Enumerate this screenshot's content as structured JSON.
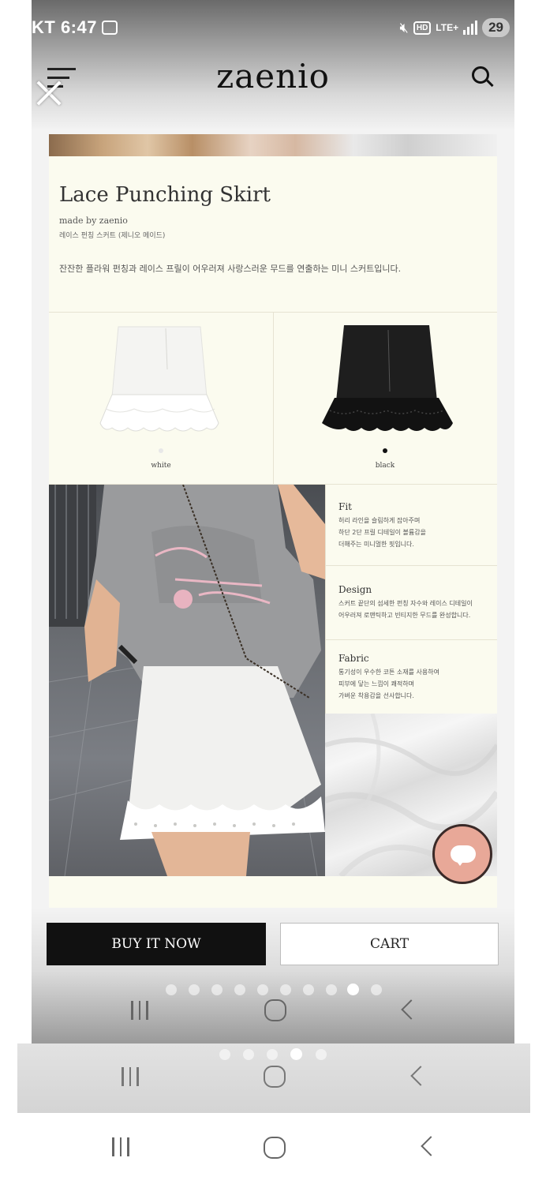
{
  "status_bar": {
    "carrier_time": "KT 6:47",
    "hd_label": "HD",
    "network": "LTE+",
    "battery": "29"
  },
  "header": {
    "brand": "zaenio"
  },
  "product": {
    "title": "Lace Punching Skirt",
    "made_by": "made by zaenio",
    "korean_name": "레이스 펀칭 스커트 (제니오 메이드)",
    "description": "잔잔한 플라워 펀칭과 레이스 프릴이 어우러져 사랑스러운 무드를 연출하는 미니 스커트입니다.",
    "colors": [
      {
        "label": "white",
        "swatch": "#e8e8e8"
      },
      {
        "label": "black",
        "swatch": "#111111"
      }
    ],
    "specs": [
      {
        "title": "Fit",
        "lines": [
          "허리 라인을 슬림하게 잡아주며",
          "하단 2단 프릴 디테일이 볼륨감을",
          "더해주는 미니멀한 핏입니다."
        ]
      },
      {
        "title": "Design",
        "lines": [
          "스커트 끝단의 섬세한 펀칭 자수와 레이스 디테일이",
          "어우러져 로맨틱하고 빈티지한 무드를 완성합니다."
        ]
      },
      {
        "title": "Fabric",
        "lines": [
          "통기성이 우수한 코튼 소재를 사용하여",
          "피부에 닿는 느낌이 쾌적하며",
          "가벼운 착용감을 선사합니다."
        ]
      }
    ]
  },
  "actions": {
    "buy_now": "BUY IT NOW",
    "cart": "CART"
  },
  "pager": {
    "inner_total": 10,
    "inner_active": 8,
    "outer_total": 5,
    "outer_active": 3
  },
  "icons": [
    "menu-icon",
    "close-icon",
    "search-icon",
    "chat-icon",
    "recents-icon",
    "home-icon",
    "back-icon"
  ],
  "colors": {
    "card_background": "#fbfbef",
    "buy_button": "#111111",
    "chat_button": "#e8a898"
  }
}
